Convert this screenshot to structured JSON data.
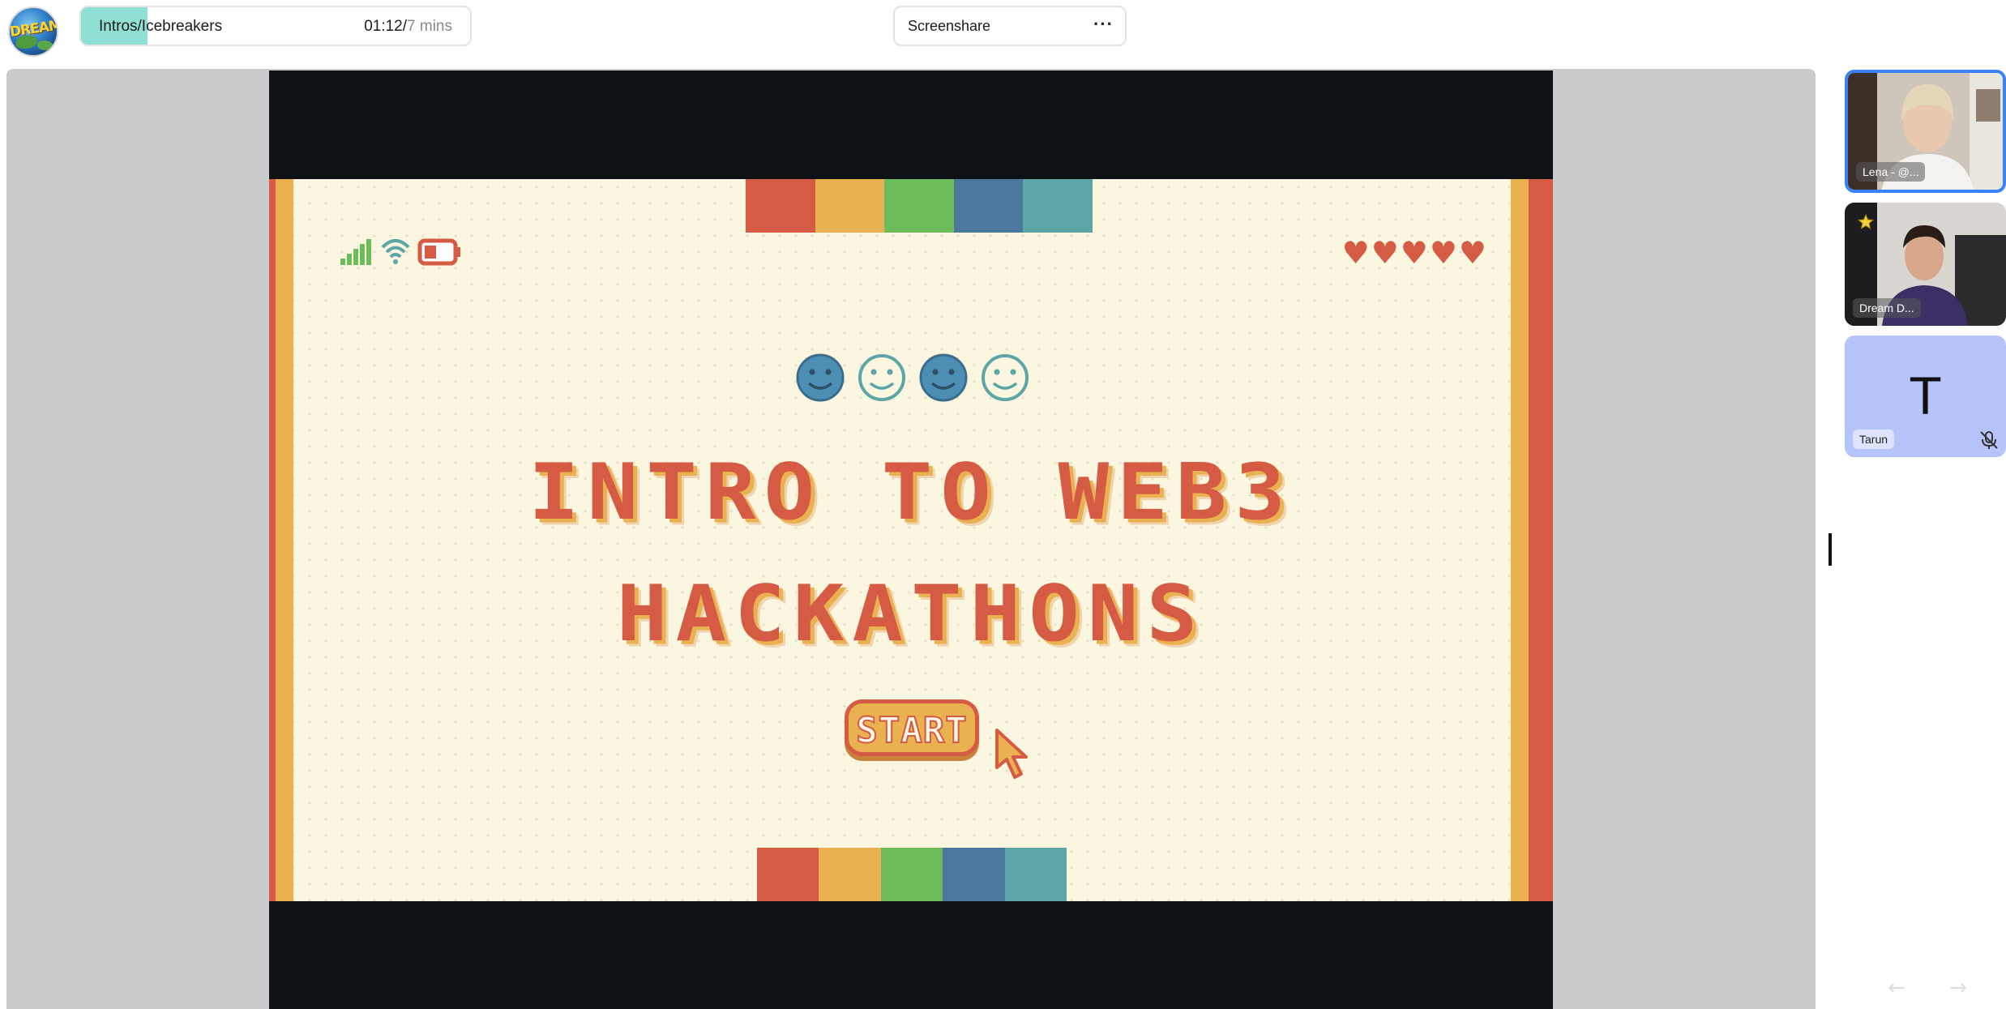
{
  "app": {
    "logo_text": "DREAM"
  },
  "agenda": {
    "title": "Intros/Icebreakers",
    "elapsed": "01:12/",
    "total": "7 mins",
    "progress_fraction": 0.17
  },
  "share": {
    "label": "Screenshare",
    "more_icon": "more-horizontal-icon"
  },
  "slide": {
    "title_line1": "INTRO TO WEB3",
    "title_line2": "HACKATHONS",
    "button_label": "START",
    "lives": "♥♥♥♥♥",
    "colors": {
      "red": "#d55b45",
      "yellow": "#e9b14f",
      "green": "#6cbc5b",
      "blue": "#4d789e",
      "teal": "#5ea5a8"
    }
  },
  "participants": [
    {
      "name": "Lena - @...",
      "active": true
    },
    {
      "name": "Dream D...",
      "host_icon": "star-icon"
    },
    {
      "name": "Tarun",
      "initial": "T",
      "muted": true
    }
  ],
  "nav": {
    "prev": "←",
    "next": "→"
  }
}
